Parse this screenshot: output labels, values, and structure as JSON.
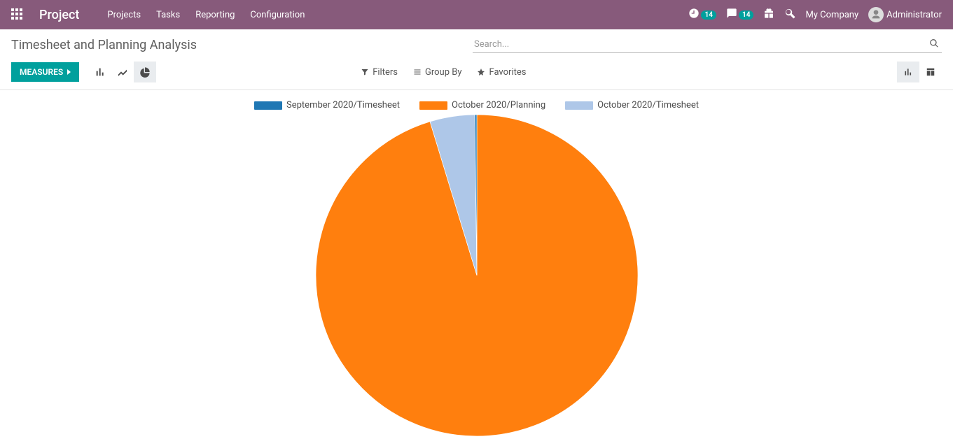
{
  "navbar": {
    "brand": "Project",
    "menu": [
      "Projects",
      "Tasks",
      "Reporting",
      "Configuration"
    ],
    "activities_count": "14",
    "messages_count": "14",
    "company": "My Company",
    "user": "Administrator"
  },
  "control_panel": {
    "title": "Timesheet and Planning Analysis",
    "search_placeholder": "Search...",
    "measures_label": "MEASURES",
    "filters_label": "Filters",
    "groupby_label": "Group By",
    "favorites_label": "Favorites"
  },
  "chart_data": {
    "type": "pie",
    "title": "",
    "series": [
      {
        "name": "September 2020/Timesheet",
        "value": 0.2,
        "color": "#1f77b4"
      },
      {
        "name": "October 2020/Planning",
        "value": 95.3,
        "color": "#ff7f0e"
      },
      {
        "name": "October 2020/Timesheet",
        "value": 4.5,
        "color": "#aec7e8"
      }
    ]
  }
}
